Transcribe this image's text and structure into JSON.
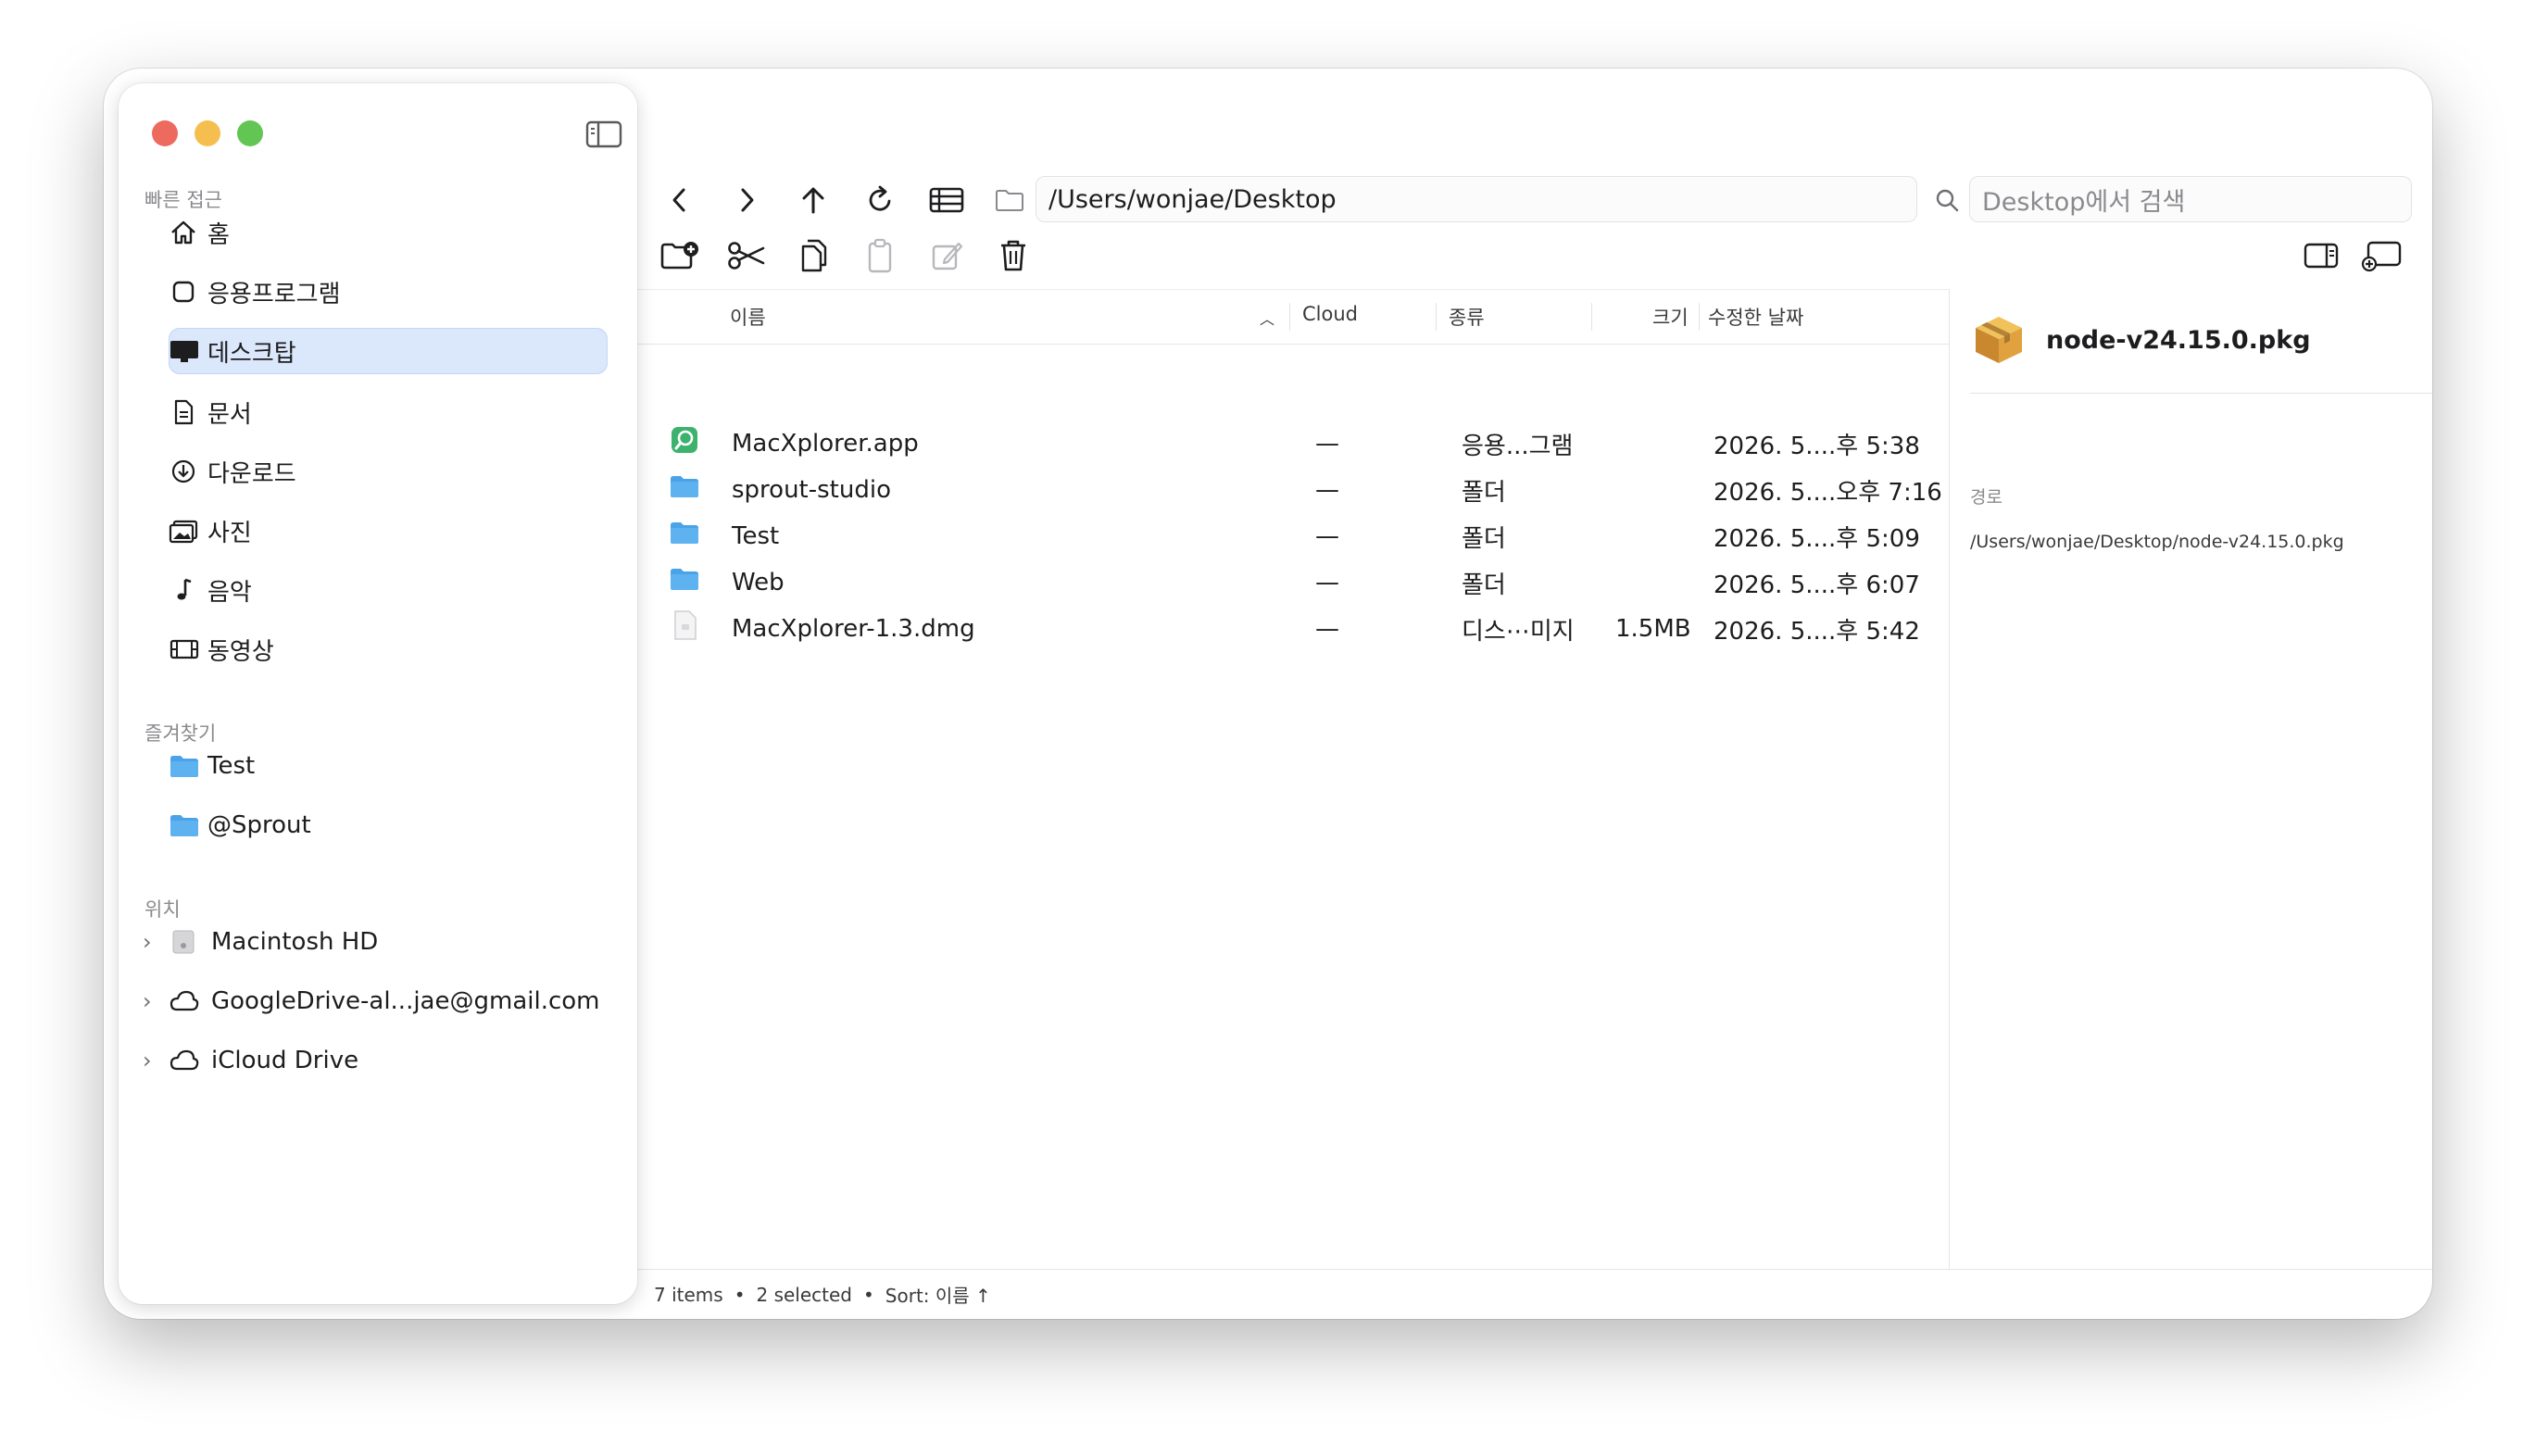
{
  "sidebar": {
    "sections": {
      "quick_access": "빠른 접근",
      "favorites": "즐겨찾기",
      "locations": "위치"
    },
    "quick_items": [
      {
        "label": "홈",
        "icon": "house-icon"
      },
      {
        "label": "응용프로그램",
        "icon": "app-square-icon"
      },
      {
        "label": "데스크탑",
        "icon": "desktop-icon",
        "selected": true
      },
      {
        "label": "문서",
        "icon": "document-icon"
      },
      {
        "label": "다운로드",
        "icon": "download-circle-icon"
      },
      {
        "label": "사진",
        "icon": "photos-icon"
      },
      {
        "label": "음악",
        "icon": "music-note-icon"
      },
      {
        "label": "동영상",
        "icon": "film-icon"
      }
    ],
    "favorite_items": [
      {
        "label": "Test",
        "icon": "folder-icon"
      },
      {
        "label": "@Sprout",
        "icon": "folder-icon"
      }
    ],
    "location_items": [
      {
        "label": "Macintosh HD",
        "icon": "hard-drive-icon"
      },
      {
        "label": "GoogleDrive-al...jae@gmail.com",
        "icon": "cloud-icon"
      },
      {
        "label": "iCloud Drive",
        "icon": "cloud-icon"
      }
    ]
  },
  "toolbar": {
    "path": "/Users/wonjae/Desktop",
    "search_placeholder": "Desktop에서 검색"
  },
  "table": {
    "columns": {
      "name": "이름",
      "cloud": "Cloud",
      "kind": "종류",
      "size": "크기",
      "modified": "수정한 날짜"
    },
    "rows": [
      {
        "name": "MacXplorer.app",
        "cloud": "—",
        "kind": "응용...그램",
        "size": "",
        "modified": "2026. 5....후 5:38",
        "icon": "app-icon"
      },
      {
        "name": "sprout-studio",
        "cloud": "—",
        "kind": "폴더",
        "size": "",
        "modified": "2026. 5....오후 7:16",
        "icon": "folder-icon"
      },
      {
        "name": "Test",
        "cloud": "—",
        "kind": "폴더",
        "size": "",
        "modified": "2026. 5....후 5:09",
        "icon": "folder-icon"
      },
      {
        "name": "Web",
        "cloud": "—",
        "kind": "폴더",
        "size": "",
        "modified": "2026. 5....후 6:07",
        "icon": "folder-icon"
      },
      {
        "name": "MacXplorer-1.3.dmg",
        "cloud": "—",
        "kind": "디스⋯미지",
        "size": "1.5MB",
        "modified": "2026. 5....후 5:42",
        "icon": "disk-image-icon"
      }
    ]
  },
  "info": {
    "filename": "node-v24.15.0.pkg",
    "path_label": "경로",
    "path_value": "/Users/wonjae/Desktop/node-v24.15.0.pkg"
  },
  "status": {
    "items": "7 items",
    "selected": "2 selected",
    "sort": "Sort: 이름 ↑"
  },
  "colors": {
    "accent_selection": "#dbe7fb",
    "folder": "#4aa3e8",
    "close": "#ed6a5e",
    "minimize": "#f5bf4f",
    "zoom": "#62c554"
  }
}
